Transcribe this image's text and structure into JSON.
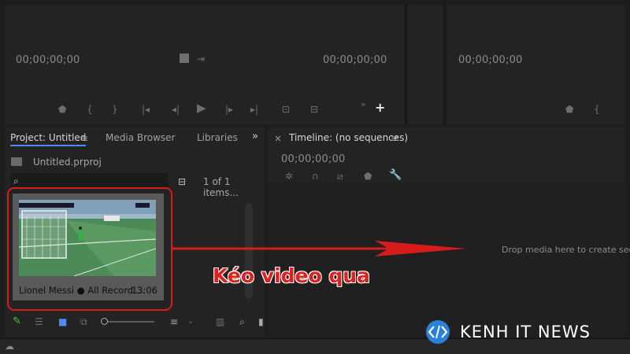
{
  "source_monitor": {
    "timecode_left": "00;00;00;00",
    "timecode_right": "00;00;00;00"
  },
  "program_monitor": {
    "timecode": "00;00;00;00"
  },
  "project_panel": {
    "tabs": [
      {
        "label": "Project: Untitled",
        "active": true
      },
      {
        "label": "Media Browser",
        "active": false
      },
      {
        "label": "Libraries",
        "active": false
      }
    ],
    "overflow_label": "»",
    "project_file": "Untitled.prproj",
    "items_count": "1 of 1 items...",
    "clip": {
      "name": "Lionel  Messi  ●  All Record ...",
      "duration": "13:06"
    }
  },
  "timeline_panel": {
    "close_label": "×",
    "title": "Timeline: (no sequences)",
    "timecode": "00;00;00;00",
    "drop_text": "Drop media here to create seque"
  },
  "annotation": {
    "text": "Kéo video qua",
    "color": "#e0201c"
  },
  "watermark": {
    "text": "KENH IT NEWS"
  },
  "colors": {
    "accent": "#4b8df8",
    "highlight": "#d81c1c",
    "panel": "#232323",
    "background": "#1d1d1d"
  }
}
